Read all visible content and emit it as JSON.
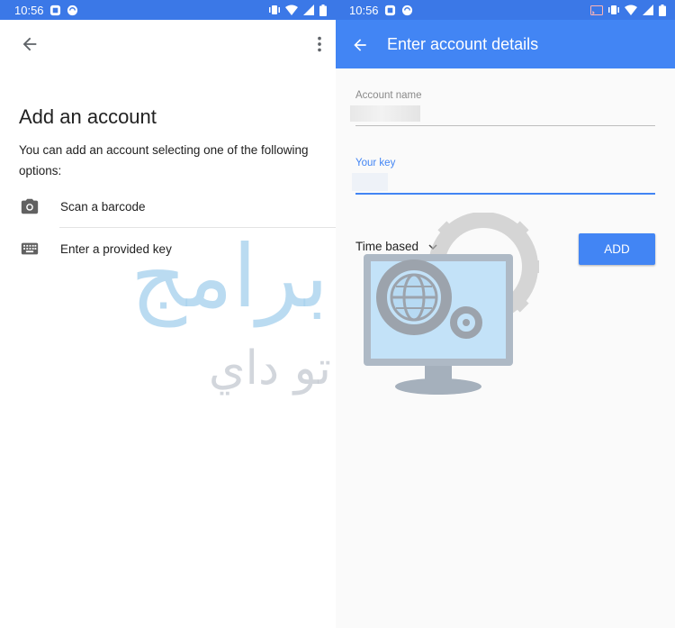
{
  "left": {
    "status": {
      "time": "10:56"
    },
    "title": "Add an account",
    "description": "You can add an account selecting one of the following options:",
    "options": [
      {
        "label": "Scan a barcode",
        "icon": "camera-icon"
      },
      {
        "label": "Enter a provided key",
        "icon": "keyboard-icon"
      }
    ]
  },
  "right": {
    "status": {
      "time": "10:56"
    },
    "appbar": {
      "title": "Enter account details"
    },
    "account_name": {
      "label": "Account name"
    },
    "your_key": {
      "label": "Your key"
    },
    "type_select": {
      "value": "Time based"
    },
    "add_button": "ADD"
  },
  "watermark": {
    "line1": "برامج",
    "line2": "تو داي"
  },
  "colors": {
    "primary": "#4285f4",
    "status_bar": "#3b78e7",
    "text": "#212121",
    "hint": "#8a8a8a"
  }
}
